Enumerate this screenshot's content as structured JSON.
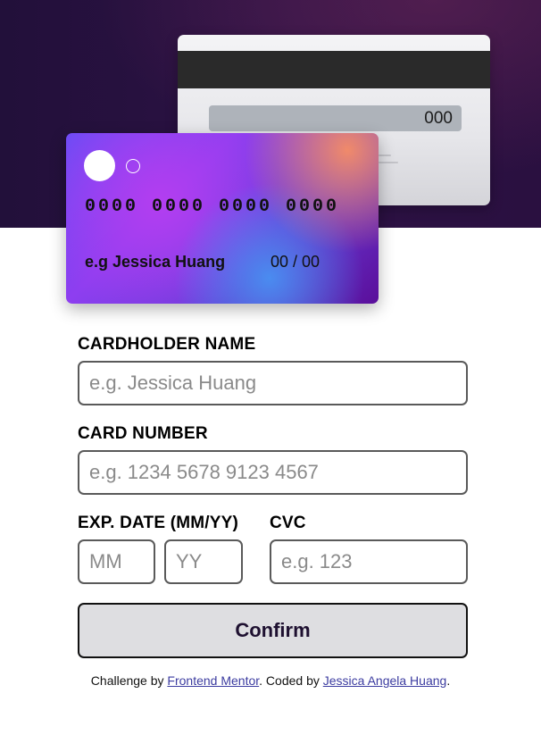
{
  "card_back": {
    "cvc": "000"
  },
  "card_front": {
    "number": "0000 0000 0000 0000",
    "holder": "e.g Jessica Huang",
    "expiry": "00 / 00"
  },
  "form": {
    "cardholder_label": "CARDHOLDER NAME",
    "cardholder_placeholder": "e.g. Jessica Huang",
    "number_label": "CARD NUMBER",
    "number_placeholder": "e.g. 1234 5678 9123 4567",
    "exp_label": "EXP. DATE (MM/YY)",
    "mm_placeholder": "MM",
    "yy_placeholder": "YY",
    "cvc_label": "CVC",
    "cvc_placeholder": "e.g. 123",
    "confirm_label": "Confirm"
  },
  "footer": {
    "prefix": "Challenge by ",
    "link1": "Frontend Mentor",
    "middle": ". Coded by ",
    "link2": "Jessica Angela Huang",
    "suffix": "."
  }
}
